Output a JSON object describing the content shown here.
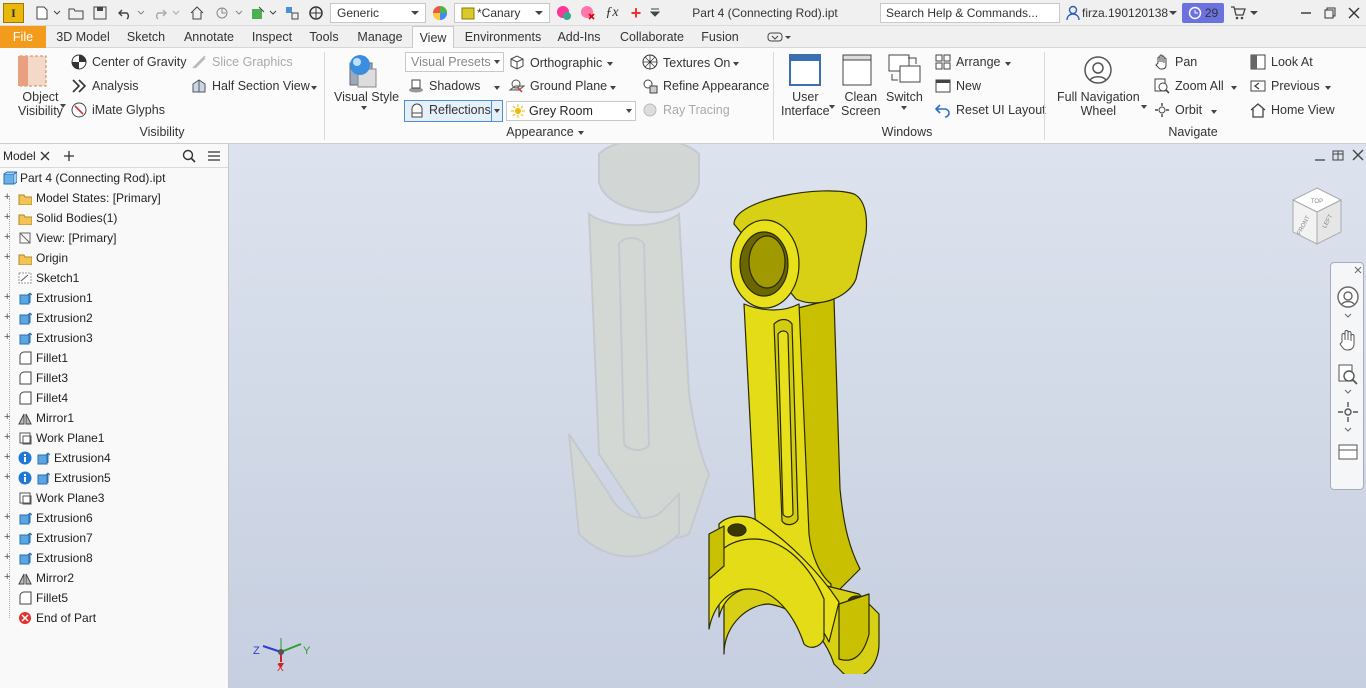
{
  "titlebar": {
    "logo": "I",
    "style": "Generic",
    "appearance": "*Canary",
    "doc_title": "Part 4 (Connecting Rod).ipt",
    "search_placeholder": "Search Help & Commands...",
    "user": "firza.190120138",
    "badge": "29"
  },
  "tabs": [
    "File",
    "3D Model",
    "Sketch",
    "Annotate",
    "Inspect",
    "Tools",
    "Manage",
    "View",
    "Environments",
    "Add-Ins",
    "Collaborate",
    "Fusion"
  ],
  "ribbon": {
    "visibility": {
      "object_visibility": [
        "Object",
        "Visibility"
      ],
      "center_of_gravity": "Center of Gravity",
      "slice_graphics": "Slice Graphics",
      "analysis": "Analysis",
      "half_section": "Half Section View",
      "imate": "iMate Glyphs",
      "group": "Visibility"
    },
    "appearance": {
      "visual_style": "Visual Style",
      "visual_presets": "Visual Presets",
      "orthographic": "Orthographic",
      "textures_on": "Textures On",
      "shadows": "Shadows",
      "ground_plane": "Ground Plane",
      "refine": "Refine Appearance",
      "reflections": "Reflections",
      "grey_room": "Grey Room",
      "ray_tracing": "Ray Tracing",
      "group": "Appearance"
    },
    "windows": {
      "user_interface": [
        "User",
        "Interface"
      ],
      "clean_screen": [
        "Clean",
        "Screen"
      ],
      "switch": "Switch",
      "arrange": "Arrange",
      "new": "New",
      "reset": "Reset UI Layout",
      "group": "Windows"
    },
    "navigate": {
      "full_nav": [
        "Full Navigation",
        "Wheel"
      ],
      "pan": "Pan",
      "zoom_all": "Zoom All",
      "orbit": "Orbit",
      "look_at": "Look At",
      "previous": "Previous",
      "home_view": "Home View",
      "group": "Navigate"
    }
  },
  "browser": {
    "tab": "Model",
    "root": "Part 4 (Connecting Rod).ipt",
    "nodes": [
      "Model States: [Primary]",
      "Solid Bodies(1)",
      "View: [Primary]",
      "Origin",
      "Sketch1",
      "Extrusion1",
      "Extrusion2",
      "Extrusion3",
      "Fillet1",
      "Fillet3",
      "Fillet4",
      "Mirror1",
      "Work Plane1",
      "Extrusion4",
      "Extrusion5",
      "Work Plane3",
      "Extrusion6",
      "Extrusion7",
      "Extrusion8",
      "Mirror2",
      "Fillet5",
      "End of Part"
    ]
  },
  "viewcube": {
    "faces": [
      "LEFT",
      "FRONT",
      "TOP"
    ]
  },
  "triad": {
    "z": "Z",
    "x": "X",
    "y": "Y"
  },
  "colors": {
    "part": "#e8e01a",
    "edge": "#2a2a00",
    "file_tab": "#f29b1c",
    "viewport_top": "#dde3ee",
    "viewport_bottom": "#c6cfe0"
  }
}
